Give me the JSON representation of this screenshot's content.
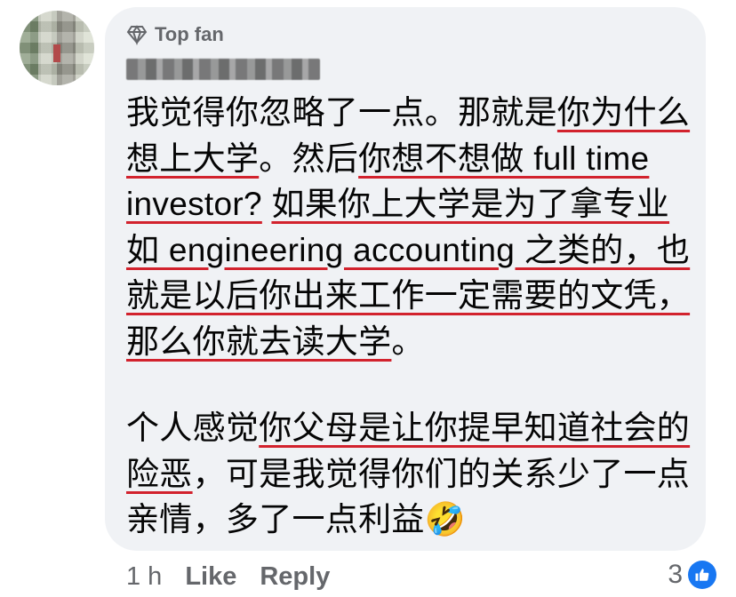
{
  "badge": {
    "icon": "diamond-icon",
    "label": "Top fan"
  },
  "author": {
    "name": ""
  },
  "comment": {
    "paragraph1": [
      {
        "text": "我觉得你忽略了一点。那就是",
        "underline": false
      },
      {
        "text": "你为什么想上大学",
        "underline": true
      },
      {
        "text": "。然后",
        "underline": false
      },
      {
        "text": "你想不想做 full time investor?",
        "underline": true
      },
      {
        "text": " ",
        "underline": false
      },
      {
        "text": "如果你上大学是为了拿专业如 engineering accounting 之类的，也就是以后你出来工作一定需要的文凭，那么你就去读大学",
        "underline": true
      },
      {
        "text": "。",
        "underline": false
      }
    ],
    "paragraph2": [
      {
        "text": "个人感觉",
        "underline": false
      },
      {
        "text": "你父母是让你提早知道社会的险恶",
        "underline": true
      },
      {
        "text": "，可是我觉得你们的关系少了一点亲情，多了一点利益",
        "underline": false
      },
      {
        "text": "🤣",
        "underline": false
      }
    ]
  },
  "actions": {
    "time": "1 h",
    "like": "Like",
    "reply": "Reply"
  },
  "reactions": {
    "count": "3",
    "icon": "thumbs-up-icon",
    "color": "#1877f2"
  },
  "colors": {
    "bubble": "#f0f2f5",
    "underline": "#d2222d",
    "meta": "#65676b"
  }
}
